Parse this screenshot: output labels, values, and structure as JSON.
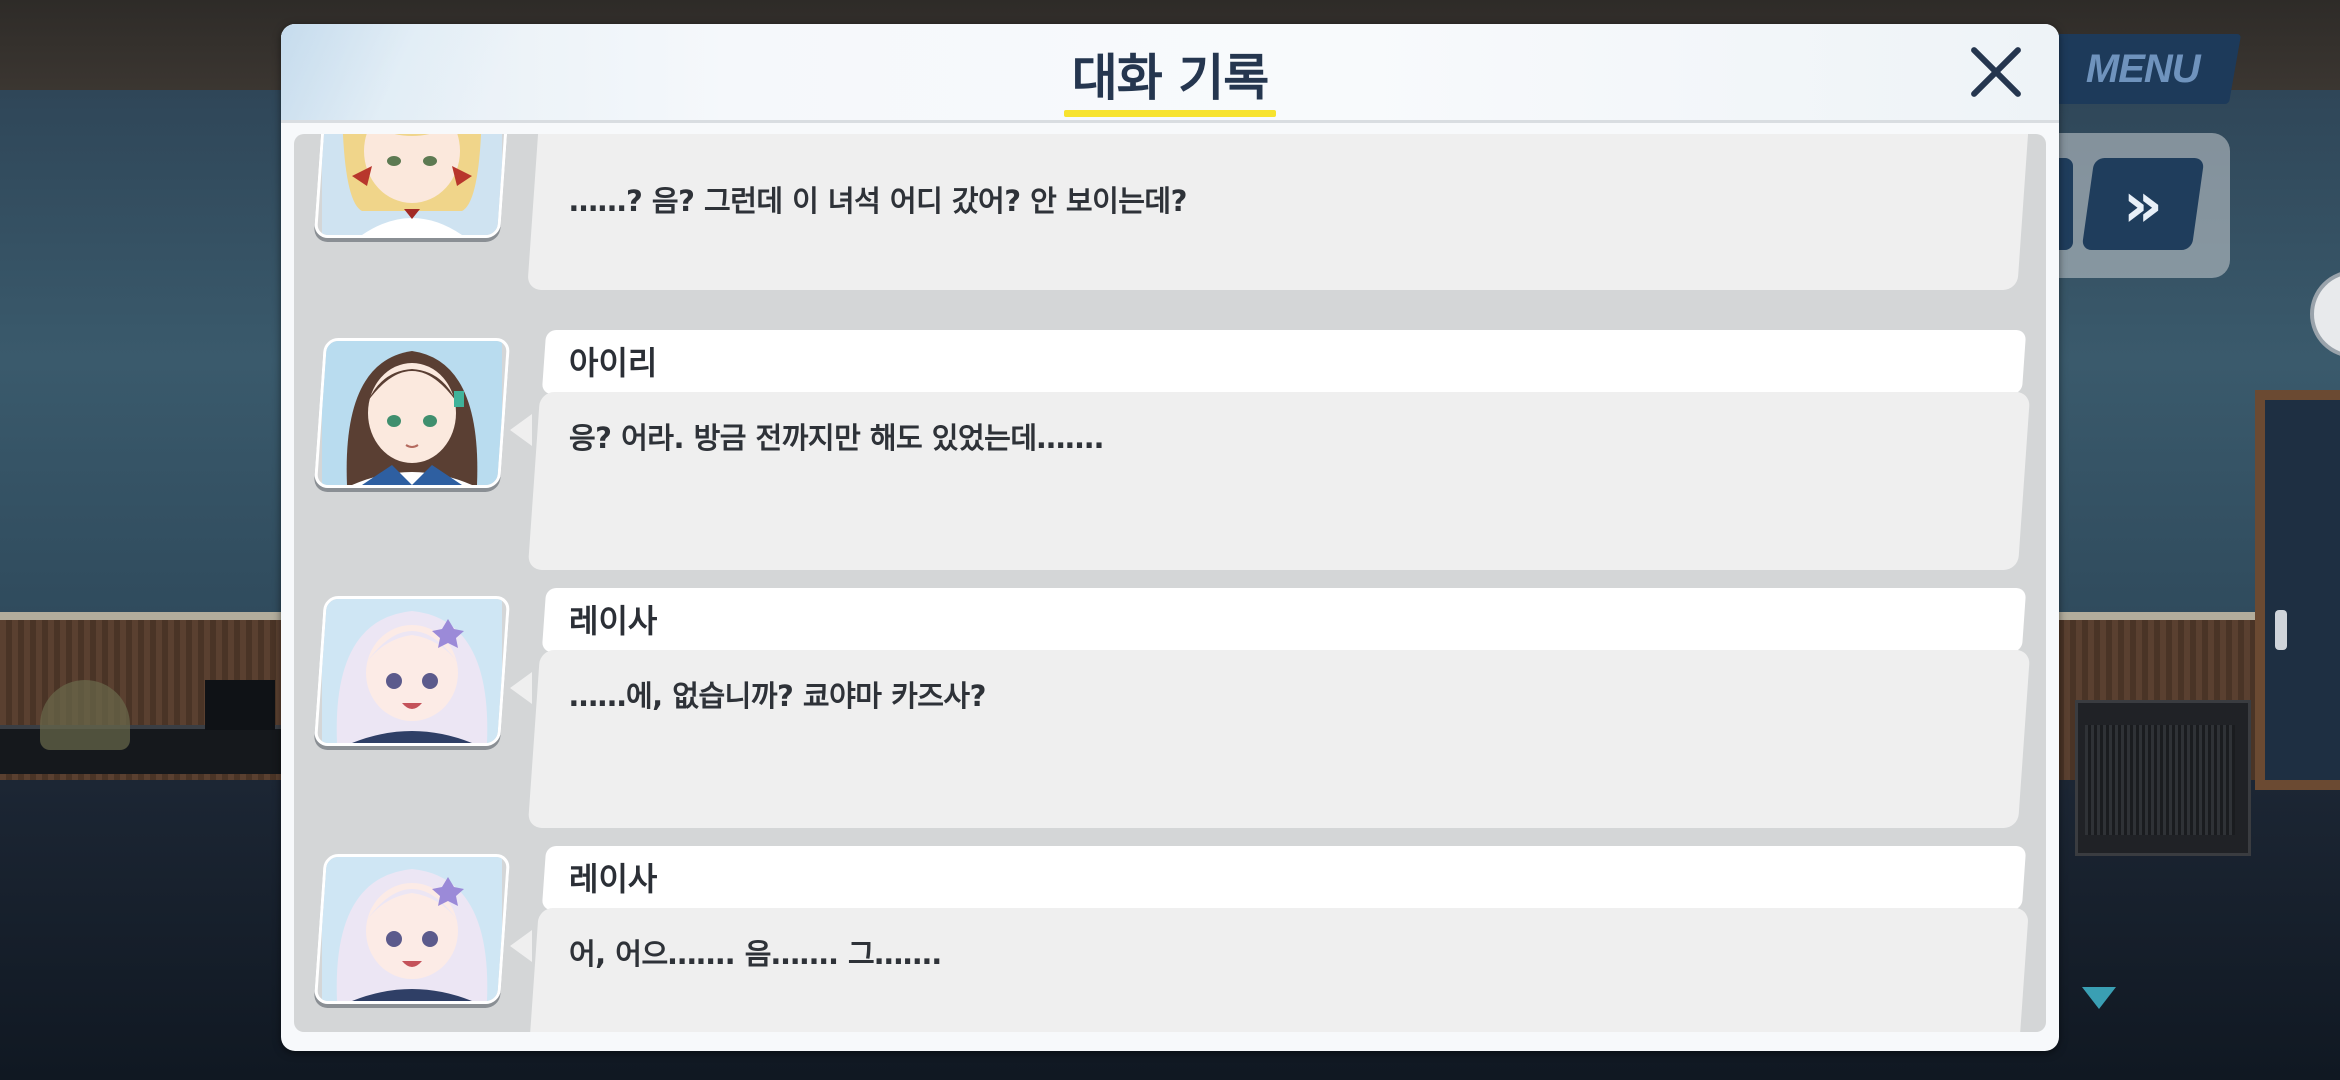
{
  "hud": {
    "menu_label": "MENU",
    "auto_label": "»",
    "scroll_down_icon": "triangle-down-icon"
  },
  "dialog": {
    "title": "대화 기록",
    "close_icon": "close-icon",
    "colors": {
      "title": "#25364f",
      "underline": "#f7e32f"
    }
  },
  "log": {
    "entries": [
      {
        "avatar": "blonde-girl-portrait",
        "name": "",
        "message": "……? 음? 그런데 이 녀석 어디 갔어? 안 보이는데?"
      },
      {
        "avatar": "airi-portrait",
        "name": "아이리",
        "message": "응? 어라. 방금 전까지만 해도 있었는데……."
      },
      {
        "avatar": "reisa-portrait",
        "name": "레이사",
        "message": "……에, 없습니까? 쿄야마 카즈사?"
      },
      {
        "avatar": "reisa-portrait",
        "name": "레이사",
        "message": "어, 어으……. 음……. 그……."
      }
    ]
  }
}
